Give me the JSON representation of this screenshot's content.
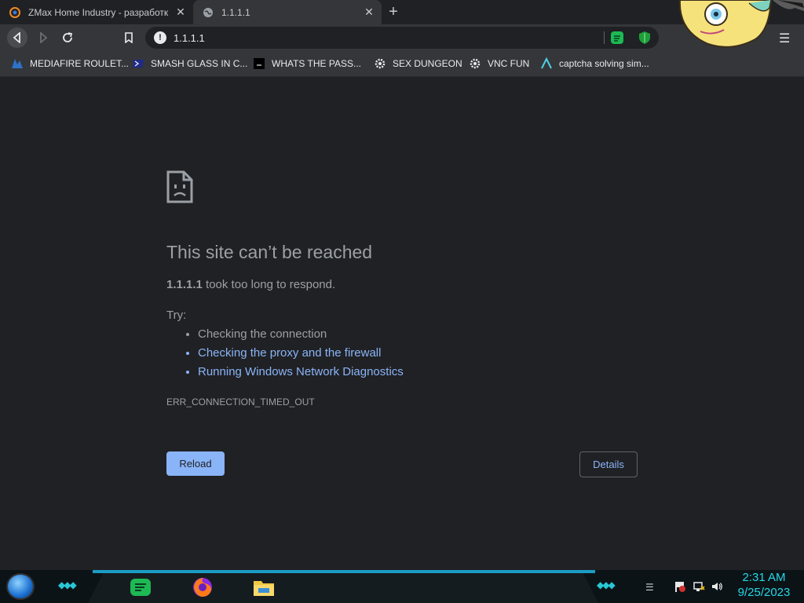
{
  "tabs": [
    {
      "title": "ZMax Home Industry - разработк",
      "active": false
    },
    {
      "title": "1.1.1.1",
      "active": true
    }
  ],
  "toolbar": {
    "url": "1.1.1.1",
    "info_glyph": "!"
  },
  "bookmarks": [
    {
      "label": "MEDIAFIRE ROULET...",
      "icon": "mediafire-icon"
    },
    {
      "label": "SMASH GLASS IN C...",
      "icon": "powershell-icon"
    },
    {
      "label": "WHATS THE PASS...",
      "icon": "black-square-icon"
    },
    {
      "label": "SEX DUNGEON",
      "icon": "gear-icon"
    },
    {
      "label": "VNC FUN",
      "icon": "gear-icon"
    },
    {
      "label": "captcha solving sim...",
      "icon": "lambda-icon"
    }
  ],
  "error": {
    "title": "This site can’t be reached",
    "host": "1.1.1.1",
    "message": " took too long to respond.",
    "try_label": "Try:",
    "suggestions": [
      {
        "text": "Checking the connection",
        "link": false
      },
      {
        "text": "Checking the proxy and the firewall",
        "link": true
      },
      {
        "text": "Running Windows Network Diagnostics",
        "link": true
      }
    ],
    "code": "ERR_CONNECTION_TIMED_OUT",
    "reload_label": "Reload",
    "details_label": "Details"
  },
  "taskbar": {
    "time": "2:31 AM",
    "date": "9/25/2023"
  },
  "colors": {
    "accent": "#8ab4f8",
    "page_bg": "#202124",
    "toolbar_bg": "#35363a",
    "clock": "#27d7e6"
  }
}
